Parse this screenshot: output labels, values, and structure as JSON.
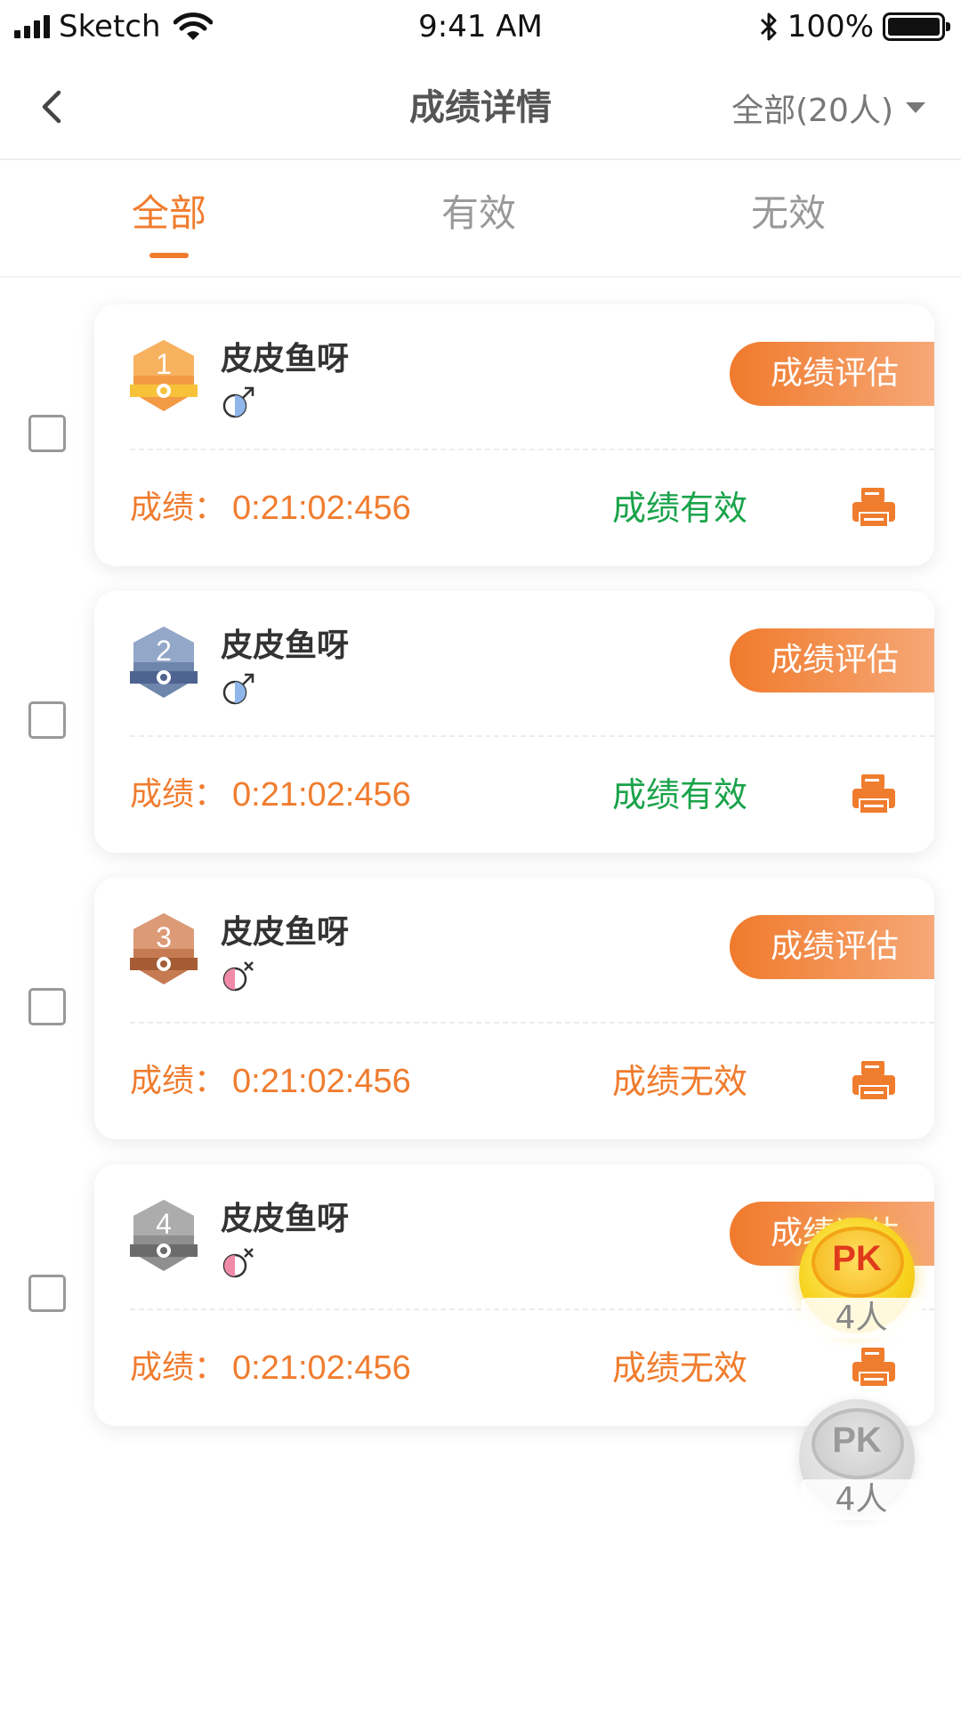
{
  "status_bar": {
    "carrier": "Sketch",
    "time": "9:41 AM",
    "battery": "100%"
  },
  "nav": {
    "title": "成绩详情",
    "filter_label": "全部(20人)"
  },
  "tabs": [
    {
      "label": "全部"
    },
    {
      "label": "有效"
    },
    {
      "label": "无效"
    }
  ],
  "records": [
    {
      "rank": "1",
      "name": "皮皮鱼呀",
      "gender": "male",
      "eval_label": "成绩评估",
      "score_label": "成绩：",
      "score": "0:21:02:456",
      "status": "成绩有效"
    },
    {
      "rank": "2",
      "name": "皮皮鱼呀",
      "gender": "male",
      "eval_label": "成绩评估",
      "score_label": "成绩：",
      "score": "0:21:02:456",
      "status": "成绩有效"
    },
    {
      "rank": "3",
      "name": "皮皮鱼呀",
      "gender": "female",
      "eval_label": "成绩评估",
      "score_label": "成绩：",
      "score": "0:21:02:456",
      "status": "成绩无效"
    },
    {
      "rank": "4",
      "name": "皮皮鱼呀",
      "gender": "female",
      "eval_label": "成绩评估",
      "score_label": "成绩：",
      "score": "0:21:02:456",
      "status": "成绩无效"
    }
  ],
  "pk_buttons": [
    {
      "label": "PK",
      "count": "4人"
    },
    {
      "label": "PK",
      "count": "4人"
    }
  ],
  "colors": {
    "accent": "#f07c2e",
    "valid": "#1aa34a",
    "gold": "#f0a030",
    "silver": "#7b8fb0",
    "bronze": "#c97a50",
    "gray": "#9a9a9a"
  }
}
